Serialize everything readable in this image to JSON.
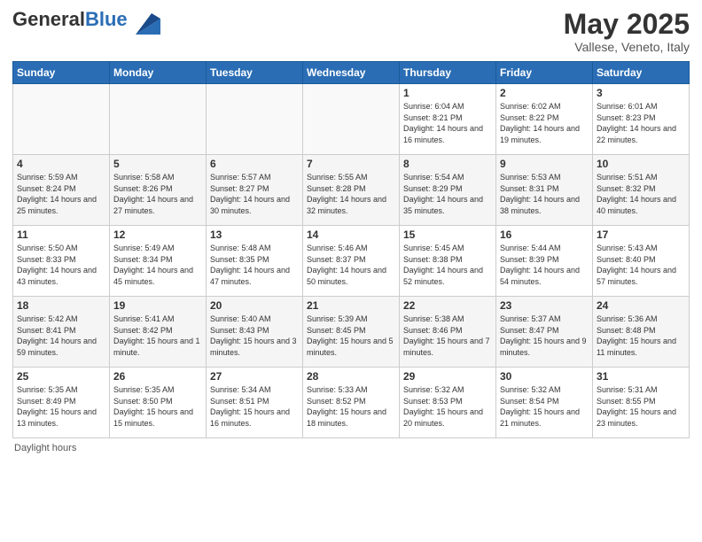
{
  "header": {
    "logo_general": "General",
    "logo_blue": "Blue",
    "month_title": "May 2025",
    "subtitle": "Vallese, Veneto, Italy"
  },
  "days_of_week": [
    "Sunday",
    "Monday",
    "Tuesday",
    "Wednesday",
    "Thursday",
    "Friday",
    "Saturday"
  ],
  "footer_note": "Daylight hours",
  "weeks": [
    [
      {
        "day": "",
        "sunrise": "",
        "sunset": "",
        "daylight": ""
      },
      {
        "day": "",
        "sunrise": "",
        "sunset": "",
        "daylight": ""
      },
      {
        "day": "",
        "sunrise": "",
        "sunset": "",
        "daylight": ""
      },
      {
        "day": "",
        "sunrise": "",
        "sunset": "",
        "daylight": ""
      },
      {
        "day": "1",
        "sunrise": "Sunrise: 6:04 AM",
        "sunset": "Sunset: 8:21 PM",
        "daylight": "Daylight: 14 hours and 16 minutes."
      },
      {
        "day": "2",
        "sunrise": "Sunrise: 6:02 AM",
        "sunset": "Sunset: 8:22 PM",
        "daylight": "Daylight: 14 hours and 19 minutes."
      },
      {
        "day": "3",
        "sunrise": "Sunrise: 6:01 AM",
        "sunset": "Sunset: 8:23 PM",
        "daylight": "Daylight: 14 hours and 22 minutes."
      }
    ],
    [
      {
        "day": "4",
        "sunrise": "Sunrise: 5:59 AM",
        "sunset": "Sunset: 8:24 PM",
        "daylight": "Daylight: 14 hours and 25 minutes."
      },
      {
        "day": "5",
        "sunrise": "Sunrise: 5:58 AM",
        "sunset": "Sunset: 8:26 PM",
        "daylight": "Daylight: 14 hours and 27 minutes."
      },
      {
        "day": "6",
        "sunrise": "Sunrise: 5:57 AM",
        "sunset": "Sunset: 8:27 PM",
        "daylight": "Daylight: 14 hours and 30 minutes."
      },
      {
        "day": "7",
        "sunrise": "Sunrise: 5:55 AM",
        "sunset": "Sunset: 8:28 PM",
        "daylight": "Daylight: 14 hours and 32 minutes."
      },
      {
        "day": "8",
        "sunrise": "Sunrise: 5:54 AM",
        "sunset": "Sunset: 8:29 PM",
        "daylight": "Daylight: 14 hours and 35 minutes."
      },
      {
        "day": "9",
        "sunrise": "Sunrise: 5:53 AM",
        "sunset": "Sunset: 8:31 PM",
        "daylight": "Daylight: 14 hours and 38 minutes."
      },
      {
        "day": "10",
        "sunrise": "Sunrise: 5:51 AM",
        "sunset": "Sunset: 8:32 PM",
        "daylight": "Daylight: 14 hours and 40 minutes."
      }
    ],
    [
      {
        "day": "11",
        "sunrise": "Sunrise: 5:50 AM",
        "sunset": "Sunset: 8:33 PM",
        "daylight": "Daylight: 14 hours and 43 minutes."
      },
      {
        "day": "12",
        "sunrise": "Sunrise: 5:49 AM",
        "sunset": "Sunset: 8:34 PM",
        "daylight": "Daylight: 14 hours and 45 minutes."
      },
      {
        "day": "13",
        "sunrise": "Sunrise: 5:48 AM",
        "sunset": "Sunset: 8:35 PM",
        "daylight": "Daylight: 14 hours and 47 minutes."
      },
      {
        "day": "14",
        "sunrise": "Sunrise: 5:46 AM",
        "sunset": "Sunset: 8:37 PM",
        "daylight": "Daylight: 14 hours and 50 minutes."
      },
      {
        "day": "15",
        "sunrise": "Sunrise: 5:45 AM",
        "sunset": "Sunset: 8:38 PM",
        "daylight": "Daylight: 14 hours and 52 minutes."
      },
      {
        "day": "16",
        "sunrise": "Sunrise: 5:44 AM",
        "sunset": "Sunset: 8:39 PM",
        "daylight": "Daylight: 14 hours and 54 minutes."
      },
      {
        "day": "17",
        "sunrise": "Sunrise: 5:43 AM",
        "sunset": "Sunset: 8:40 PM",
        "daylight": "Daylight: 14 hours and 57 minutes."
      }
    ],
    [
      {
        "day": "18",
        "sunrise": "Sunrise: 5:42 AM",
        "sunset": "Sunset: 8:41 PM",
        "daylight": "Daylight: 14 hours and 59 minutes."
      },
      {
        "day": "19",
        "sunrise": "Sunrise: 5:41 AM",
        "sunset": "Sunset: 8:42 PM",
        "daylight": "Daylight: 15 hours and 1 minute."
      },
      {
        "day": "20",
        "sunrise": "Sunrise: 5:40 AM",
        "sunset": "Sunset: 8:43 PM",
        "daylight": "Daylight: 15 hours and 3 minutes."
      },
      {
        "day": "21",
        "sunrise": "Sunrise: 5:39 AM",
        "sunset": "Sunset: 8:45 PM",
        "daylight": "Daylight: 15 hours and 5 minutes."
      },
      {
        "day": "22",
        "sunrise": "Sunrise: 5:38 AM",
        "sunset": "Sunset: 8:46 PM",
        "daylight": "Daylight: 15 hours and 7 minutes."
      },
      {
        "day": "23",
        "sunrise": "Sunrise: 5:37 AM",
        "sunset": "Sunset: 8:47 PM",
        "daylight": "Daylight: 15 hours and 9 minutes."
      },
      {
        "day": "24",
        "sunrise": "Sunrise: 5:36 AM",
        "sunset": "Sunset: 8:48 PM",
        "daylight": "Daylight: 15 hours and 11 minutes."
      }
    ],
    [
      {
        "day": "25",
        "sunrise": "Sunrise: 5:35 AM",
        "sunset": "Sunset: 8:49 PM",
        "daylight": "Daylight: 15 hours and 13 minutes."
      },
      {
        "day": "26",
        "sunrise": "Sunrise: 5:35 AM",
        "sunset": "Sunset: 8:50 PM",
        "daylight": "Daylight: 15 hours and 15 minutes."
      },
      {
        "day": "27",
        "sunrise": "Sunrise: 5:34 AM",
        "sunset": "Sunset: 8:51 PM",
        "daylight": "Daylight: 15 hours and 16 minutes."
      },
      {
        "day": "28",
        "sunrise": "Sunrise: 5:33 AM",
        "sunset": "Sunset: 8:52 PM",
        "daylight": "Daylight: 15 hours and 18 minutes."
      },
      {
        "day": "29",
        "sunrise": "Sunrise: 5:32 AM",
        "sunset": "Sunset: 8:53 PM",
        "daylight": "Daylight: 15 hours and 20 minutes."
      },
      {
        "day": "30",
        "sunrise": "Sunrise: 5:32 AM",
        "sunset": "Sunset: 8:54 PM",
        "daylight": "Daylight: 15 hours and 21 minutes."
      },
      {
        "day": "31",
        "sunrise": "Sunrise: 5:31 AM",
        "sunset": "Sunset: 8:55 PM",
        "daylight": "Daylight: 15 hours and 23 minutes."
      }
    ]
  ]
}
